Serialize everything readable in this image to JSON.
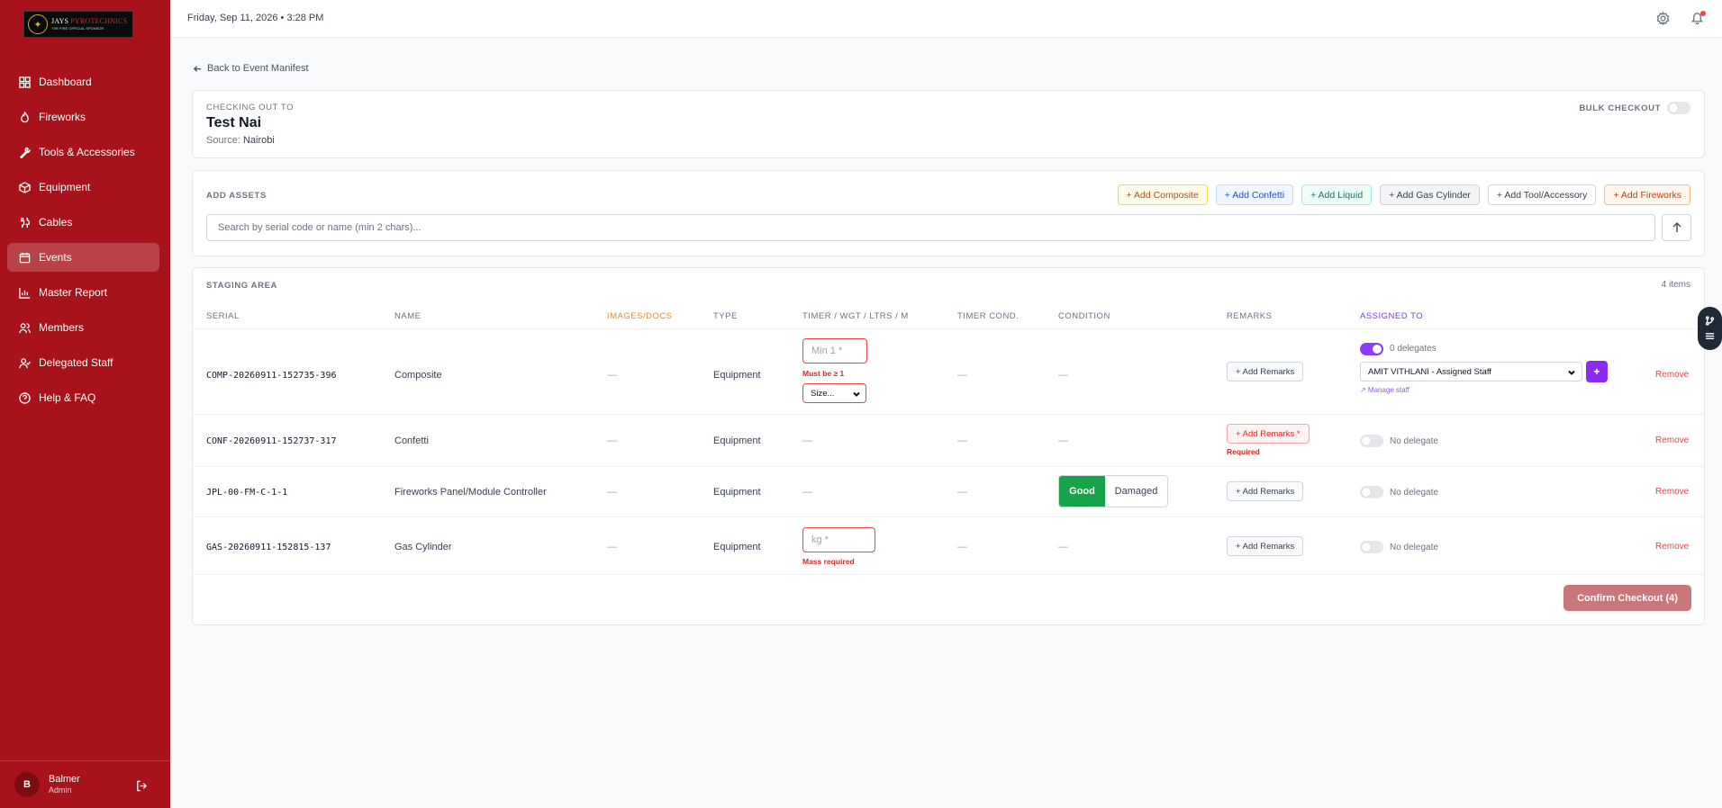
{
  "brand": {
    "line1a": "JAYS",
    "line1b": "PYROTECHNICS",
    "line2": "THE FIRE OFFICIAL SPONSOR"
  },
  "topbar": {
    "datetime": "Friday, Sep 11, 2026  •  3:28 PM"
  },
  "sidebar": {
    "items": [
      {
        "label": "Dashboard",
        "icon": "grid-icon",
        "active": false
      },
      {
        "label": "Fireworks",
        "icon": "flame-icon",
        "active": false
      },
      {
        "label": "Tools & Accessories",
        "icon": "wrench-icon",
        "active": false
      },
      {
        "label": "Equipment",
        "icon": "box-icon",
        "active": false
      },
      {
        "label": "Cables",
        "icon": "cable-icon",
        "active": false
      },
      {
        "label": "Events",
        "icon": "calendar-icon",
        "active": true
      },
      {
        "label": "Master Report",
        "icon": "bar-chart-icon",
        "active": false
      },
      {
        "label": "Members",
        "icon": "users-icon",
        "active": false
      },
      {
        "label": "Delegated Staff",
        "icon": "user-check-icon",
        "active": false
      },
      {
        "label": "Help & FAQ",
        "icon": "help-circle-icon",
        "active": false
      }
    ],
    "user": {
      "initial": "B",
      "name": "Balmer",
      "role": "Admin"
    }
  },
  "back_link": "Back to Event Manifest",
  "checkout": {
    "label": "CHECKING OUT TO",
    "name": "Test Nai",
    "source_label": "Source:",
    "source_value": "Nairobi",
    "bulk_label": "BULK CHECKOUT"
  },
  "assets": {
    "label": "ADD ASSETS",
    "buttons": [
      "+ Add Composite",
      "+ Add Confetti",
      "+ Add Liquid",
      "+ Add Gas Cylinder",
      "+ Add Tool/Accessory",
      "+ Add Fireworks"
    ],
    "search_placeholder": "Search by serial code or name (min 2 chars)..."
  },
  "staging": {
    "label": "STAGING AREA",
    "count": "4 items",
    "headers": [
      "SERIAL",
      "NAME",
      "IMAGES/DOCS",
      "TYPE",
      "TIMER / WGT / LTRS / M",
      "TIMER COND.",
      "CONDITION",
      "REMARKS",
      "ASSIGNED TO"
    ],
    "dash": "—",
    "rows": [
      {
        "serial": "COMP-20260911-152735-396",
        "name": "Composite",
        "type": "Equipment",
        "timer_placeholder": "Min 1 *",
        "timer_error": "Must be ≥ 1",
        "size_value": "Size...",
        "remarks": "+ Add Remarks",
        "delegates": "0 delegates",
        "staff": "AMIT VITHLANI - Assigned Staff",
        "plus": "+",
        "manage": "↗ Manage staff",
        "remove": "Remove"
      },
      {
        "serial": "CONF-20260911-152737-317",
        "name": "Confetti",
        "type": "Equipment",
        "remarks": "+ Add Remarks *",
        "remarks_error": "Required",
        "delegates": "No delegate",
        "remove": "Remove"
      },
      {
        "serial": "JPL-00-FM-C-1-1",
        "name": "Fireworks Panel/Module Controller",
        "type": "Equipment",
        "cond_good": "Good",
        "cond_damaged": "Damaged",
        "remarks": "+ Add Remarks",
        "delegates": "No delegate",
        "remove": "Remove"
      },
      {
        "serial": "GAS-20260911-152815-137",
        "name": "Gas Cylinder",
        "type": "Equipment",
        "timer_placeholder": "kg *",
        "timer_error": "Mass required",
        "remarks": "+ Add Remarks",
        "delegates": "No delegate",
        "remove": "Remove"
      }
    ],
    "confirm": "Confirm Checkout (4)"
  },
  "colors": {
    "sidebar": "#a8121b",
    "accent_purple": "#8b2cf5",
    "good": "#16a34a",
    "error": "#ef4444"
  }
}
